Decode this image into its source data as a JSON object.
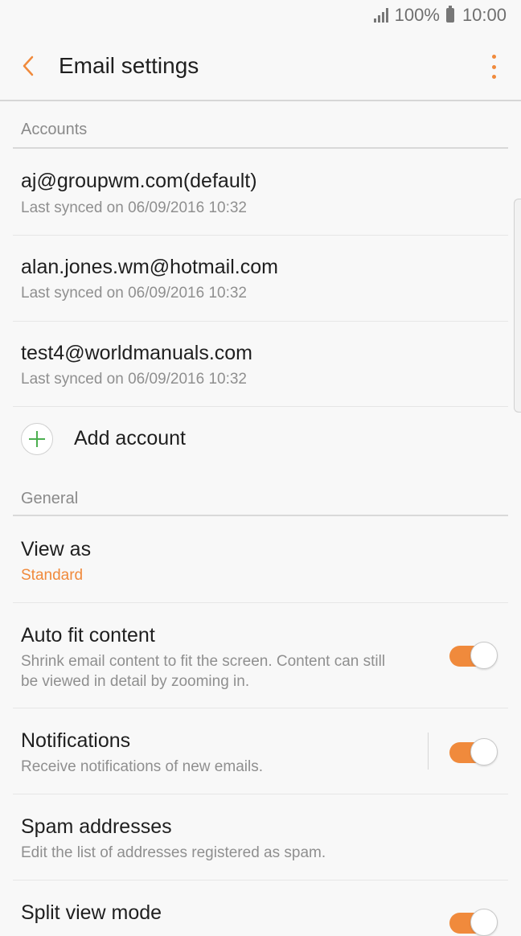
{
  "status_bar": {
    "battery": "100%",
    "time": "10:00"
  },
  "app_bar": {
    "title": "Email settings"
  },
  "accounts": {
    "header": "Accounts",
    "items": [
      {
        "email": "aj@groupwm.com(default)",
        "sync": "Last synced on 06/09/2016  10:32"
      },
      {
        "email": "alan.jones.wm@hotmail.com",
        "sync": "Last synced on 06/09/2016  10:32"
      },
      {
        "email": "test4@worldmanuals.com",
        "sync": "Last synced on 06/09/2016  10:32"
      }
    ],
    "add_label": "Add account"
  },
  "general": {
    "header": "General",
    "view_as": {
      "label": "View as",
      "value": "Standard"
    },
    "auto_fit": {
      "label": "Auto fit content",
      "desc_line1": "Shrink email content to fit the screen. Content can still",
      "desc_line2": "be viewed in detail by zooming in.",
      "enabled": true
    },
    "notifications": {
      "label": "Notifications",
      "desc": "Receive notifications of new emails.",
      "enabled": true
    },
    "spam": {
      "label": "Spam addresses",
      "desc": "Edit the list of addresses registered as spam."
    },
    "split_view": {
      "label": "Split view mode",
      "enabled": true
    }
  },
  "colors": {
    "accent": "#f08a3c",
    "add_icon": "#4caf50"
  }
}
